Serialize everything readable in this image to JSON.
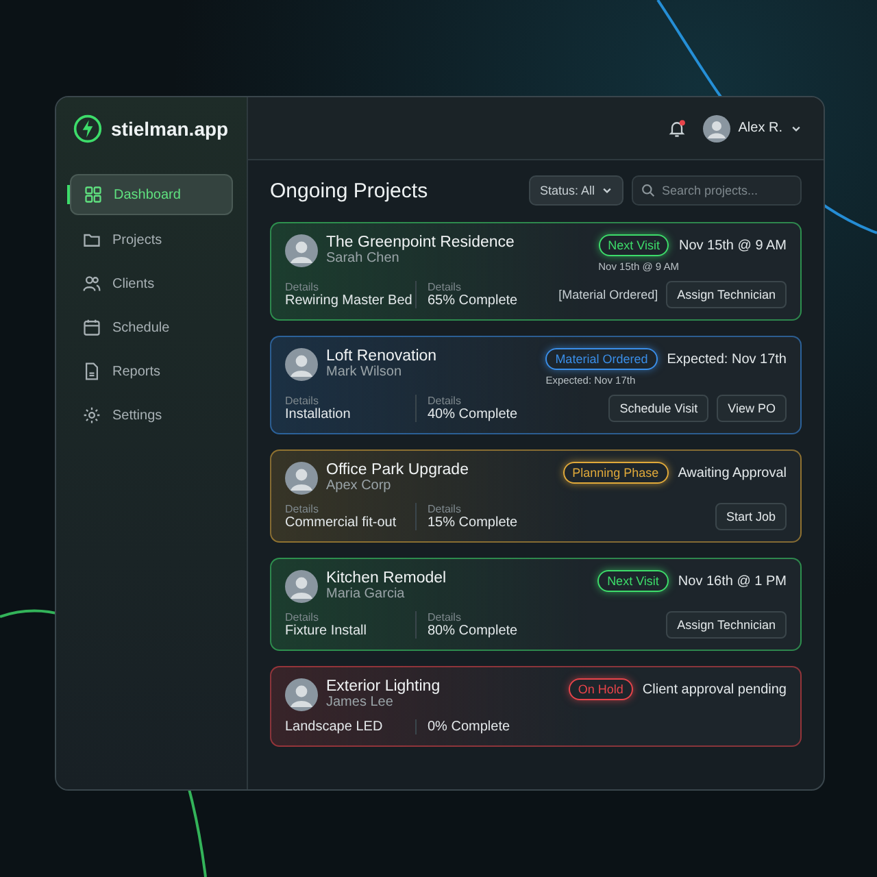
{
  "app": {
    "name": "stielman.app"
  },
  "header": {
    "notifications": {
      "unread": true
    },
    "user": {
      "name": "Alex R."
    }
  },
  "sidebar": {
    "items": [
      {
        "label": "Dashboard",
        "selected": true,
        "kind": "grid"
      },
      {
        "label": "Projects",
        "selected": false,
        "kind": "folder"
      },
      {
        "label": "Clients",
        "selected": false,
        "kind": "people"
      },
      {
        "label": "Schedule",
        "selected": false,
        "kind": "calendar"
      },
      {
        "label": "Reports",
        "selected": false,
        "kind": "document"
      },
      {
        "label": "Settings",
        "selected": false,
        "kind": "gear"
      }
    ]
  },
  "page": {
    "title": "Ongoing Projects",
    "status_filter": "Status: All",
    "search": {
      "placeholder": "Search projects..."
    }
  },
  "projects": [
    {
      "title": "The Greenpoint Residence",
      "client": "Sarah Chen",
      "color": "#3ddc6a",
      "status": "Next Visit",
      "status_note": "Nov 15th @ 9 AM",
      "status_detail": "Nov 15th @ 9 AM",
      "details": [
        {
          "label": "Details",
          "value": "Rewiring Master Bed"
        },
        {
          "label": "Details",
          "value": "65% Complete"
        }
      ],
      "tag": "[Material Ordered]",
      "actions": [
        "Assign Technician"
      ]
    },
    {
      "title": "Loft Renovation",
      "client": "Mark Wilson",
      "color": "#3a8ee8",
      "status": "Material Ordered",
      "status_note": "Expected: Nov 17th",
      "status_detail": "Expected: Nov 17th",
      "details": [
        {
          "label": "Details",
          "value": "Installation"
        },
        {
          "label": "Details",
          "value": "40% Complete"
        }
      ],
      "actions": [
        "Schedule Visit",
        "View PO"
      ]
    },
    {
      "title": "Office Park Upgrade",
      "client": "Apex Corp",
      "color": "#e0a93a",
      "status": "Planning Phase",
      "status_note": "Awaiting Approval",
      "details": [
        {
          "label": "Details",
          "value": "Commercial fit-out"
        },
        {
          "label": "Details",
          "value": "15% Complete"
        }
      ],
      "actions": [
        "Start Job"
      ]
    },
    {
      "title": "Kitchen Remodel",
      "client": "Maria Garcia",
      "color": "#3ddc6a",
      "status": "Next Visit",
      "status_note": "Nov 16th @ 1 PM",
      "details": [
        {
          "label": "Details",
          "value": "Fixture Install"
        },
        {
          "label": "Details",
          "value": "80% Complete"
        }
      ],
      "actions": [
        "Assign Technician"
      ]
    },
    {
      "title": "Exterior Lighting",
      "client": "James Lee",
      "color": "#e8444a",
      "status": "On Hold",
      "status_note": "Client approval pending",
      "details": [
        {
          "value": "Landscape LED"
        },
        {
          "value": "0% Complete"
        }
      ]
    }
  ]
}
